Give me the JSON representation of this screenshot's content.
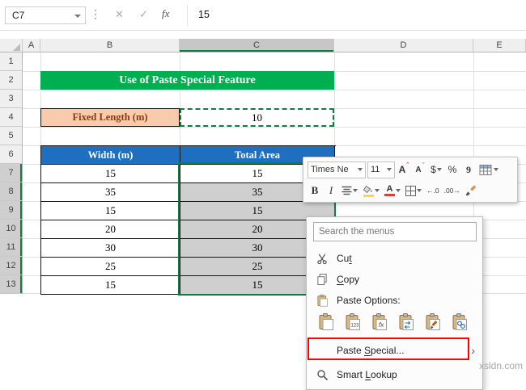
{
  "colors": {
    "banner-green": "#00B050",
    "header-blue": "#1E6FC0",
    "peach": "#F8CBAD",
    "maroon": "#8B3A0E",
    "selection-gray": "#CFCFCF",
    "excel-green": "#107C41",
    "annotation-red": "#FF0000",
    "grid-line": "#E0E0E0"
  },
  "formula_bar": {
    "name_box_value": "C7",
    "cancel_glyph": "✕",
    "enter_glyph": "✓",
    "fx_glyph": "fx",
    "value": "15"
  },
  "grid": {
    "columns": [
      "A",
      "B",
      "C",
      "D",
      "E"
    ],
    "rows": [
      "1",
      "2",
      "3",
      "4",
      "5",
      "6",
      "7",
      "8",
      "9",
      "10",
      "11",
      "12",
      "13"
    ],
    "selected_cell": "C7",
    "selected_range": "C7:C13"
  },
  "sheet": {
    "banner_title": "Use of Paste Special Feature",
    "fixed_length_label": "Fixed Length (m)",
    "fixed_length_value": "10",
    "table": {
      "col1_header": "Width (m)",
      "col2_header": "Total Area",
      "rows": [
        {
          "width": "15",
          "area": "15"
        },
        {
          "width": "35",
          "area": "35"
        },
        {
          "width": "15",
          "area": "15"
        },
        {
          "width": "20",
          "area": "20"
        },
        {
          "width": "30",
          "area": "30"
        },
        {
          "width": "25",
          "area": "25"
        },
        {
          "width": "15",
          "area": "15"
        }
      ]
    }
  },
  "mini_toolbar": {
    "font_name": "Times Ne",
    "font_size": "11",
    "grow_font_glyph": "A",
    "shrink_font_glyph": "A",
    "accounting_glyph": "$",
    "percent_glyph": "%",
    "comma_glyph": "9",
    "bold_glyph": "B",
    "italic_glyph": "I",
    "font_color_glyph": "A",
    "increase_decimal_glyph": "←.0",
    "decrease_decimal_glyph": ".00→"
  },
  "context_menu": {
    "search_placeholder": "Search the menus",
    "cut": {
      "pre": "Cu",
      "key": "t",
      "post": ""
    },
    "copy": {
      "pre": "",
      "key": "C",
      "post": "opy"
    },
    "paste_options_label": "Paste Options:",
    "paste_special": {
      "pre": "Paste ",
      "key": "S",
      "post": "pecial..."
    },
    "smart_lookup": {
      "pre": "Smart ",
      "key": "L",
      "post": "ookup"
    },
    "submenu_glyph": "›"
  },
  "watermark": "xsldn.com"
}
